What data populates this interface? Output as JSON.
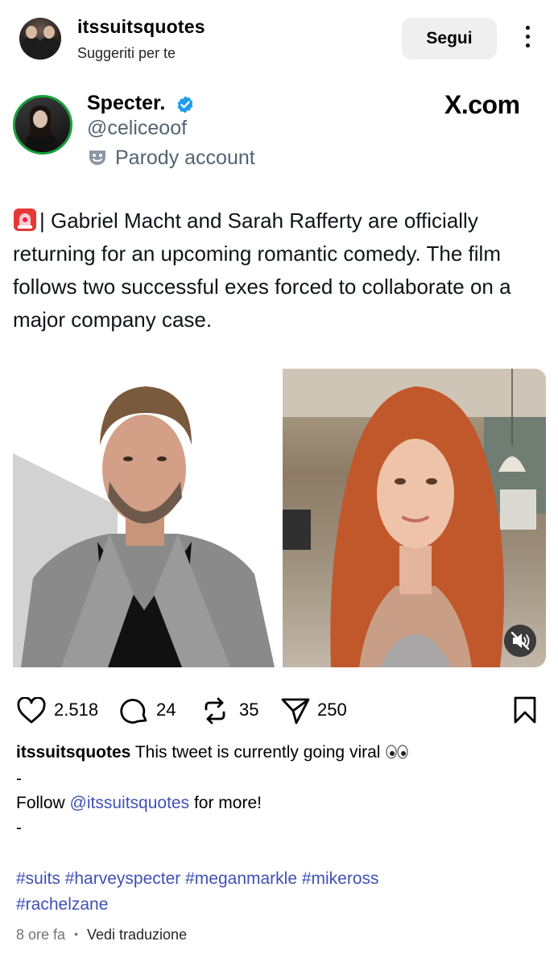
{
  "header": {
    "username": "itssuitsquotes",
    "subtitle": "Suggeriti per te",
    "follow_label": "Segui"
  },
  "tweet": {
    "display_name": "Specter.",
    "handle": "@celiceoof",
    "parody_label": "Parody account",
    "source_logo": "X.com",
    "body": "| Gabriel Macht and Sarah Rafferty are officially returning for an upcoming romantic comedy. The film follows two successful exes forced to collaborate on a major company case.",
    "verified_color": "#1d9bf0",
    "avatar_ring_color": "#1a9e3c"
  },
  "actions": {
    "likes": "2.518",
    "comments": "24",
    "reposts": "35",
    "shares": "250"
  },
  "caption": {
    "user": "itssuitsquotes",
    "text": "This tweet is currently going viral",
    "dash": "-",
    "follow_prefix": "Follow",
    "mention": "@itssuitsquotes",
    "follow_suffix": "for more!",
    "hashtags_line1": "#suits #harveyspecter #meganmarkle #mikeross",
    "hashtags_line2": "#rachelzane",
    "link_color": "#3f51b5"
  },
  "meta": {
    "time": "8 ore fa",
    "separator": "•",
    "translate": "Vedi traduzione"
  },
  "icons": [
    "heart-icon",
    "comment-icon",
    "repost-icon",
    "share-icon",
    "bookmark-icon",
    "mute-icon",
    "verified-icon",
    "parody-mask-icon",
    "siren-emoji-icon",
    "eyes-emoji-icon"
  ]
}
